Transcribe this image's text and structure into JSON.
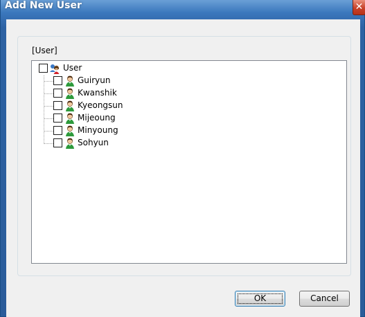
{
  "window": {
    "title": "Add New User"
  },
  "group": {
    "label": "[User]"
  },
  "tree": {
    "root": {
      "label": "User"
    },
    "children": [
      {
        "label": "Guiryun"
      },
      {
        "label": "Kwanshik"
      },
      {
        "label": "Kyeongsun"
      },
      {
        "label": "Mijeoung"
      },
      {
        "label": "Minyoung"
      },
      {
        "label": "Sohyun"
      }
    ]
  },
  "buttons": {
    "ok": "OK",
    "cancel": "Cancel"
  },
  "colors": {
    "titlebar": "#2d62a3",
    "close": "#c8412a",
    "dialog_bg": "#f0f0f0"
  }
}
